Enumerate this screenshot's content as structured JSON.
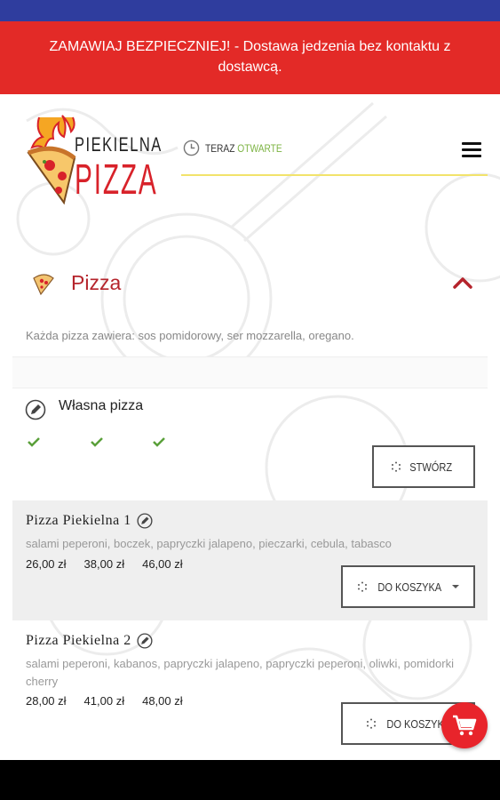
{
  "banner": {
    "text": "ZAMAWIAJ BEZPIECZNIEJ! - Dostawa jedzenia bez kontaktu z dostawcą."
  },
  "logo": {
    "line1": "PIEKIELNA",
    "line2": "PIZZA"
  },
  "status": {
    "label": "TERAZ",
    "value": "OTWARTE"
  },
  "section": {
    "title": "Pizza",
    "description": "Każda pizza zawiera: sos pomidorowy, ser mozzarella, oregano."
  },
  "own_pizza": {
    "title": "Własna pizza",
    "button": "STWÓRZ"
  },
  "items": [
    {
      "name": "Pizza Piekielna 1",
      "ingredients": "salami peperoni, boczek, papryczki jalapeno, pieczarki, cebula, tabasco",
      "prices": [
        "26,00 zł",
        "38,00 zł",
        "46,00 zł"
      ],
      "button": "DO KOSZYKA"
    },
    {
      "name": "Pizza Piekielna 2",
      "ingredients": "salami peperoni, kabanos, papryczki jalapeno, papryczki peperoni, oliwki, pomidorki cherry",
      "prices": [
        "28,00 zł",
        "41,00 zł",
        "48,00 zł"
      ],
      "button": "DO KOSZYKA"
    }
  ],
  "colors": {
    "status_bar": "#2f3d9e",
    "banner": "#e32a27",
    "accent_red": "#b5242c",
    "open_green": "#7cb342",
    "check_green": "#5aa03a",
    "underline_yellow": "#f2e36b"
  }
}
